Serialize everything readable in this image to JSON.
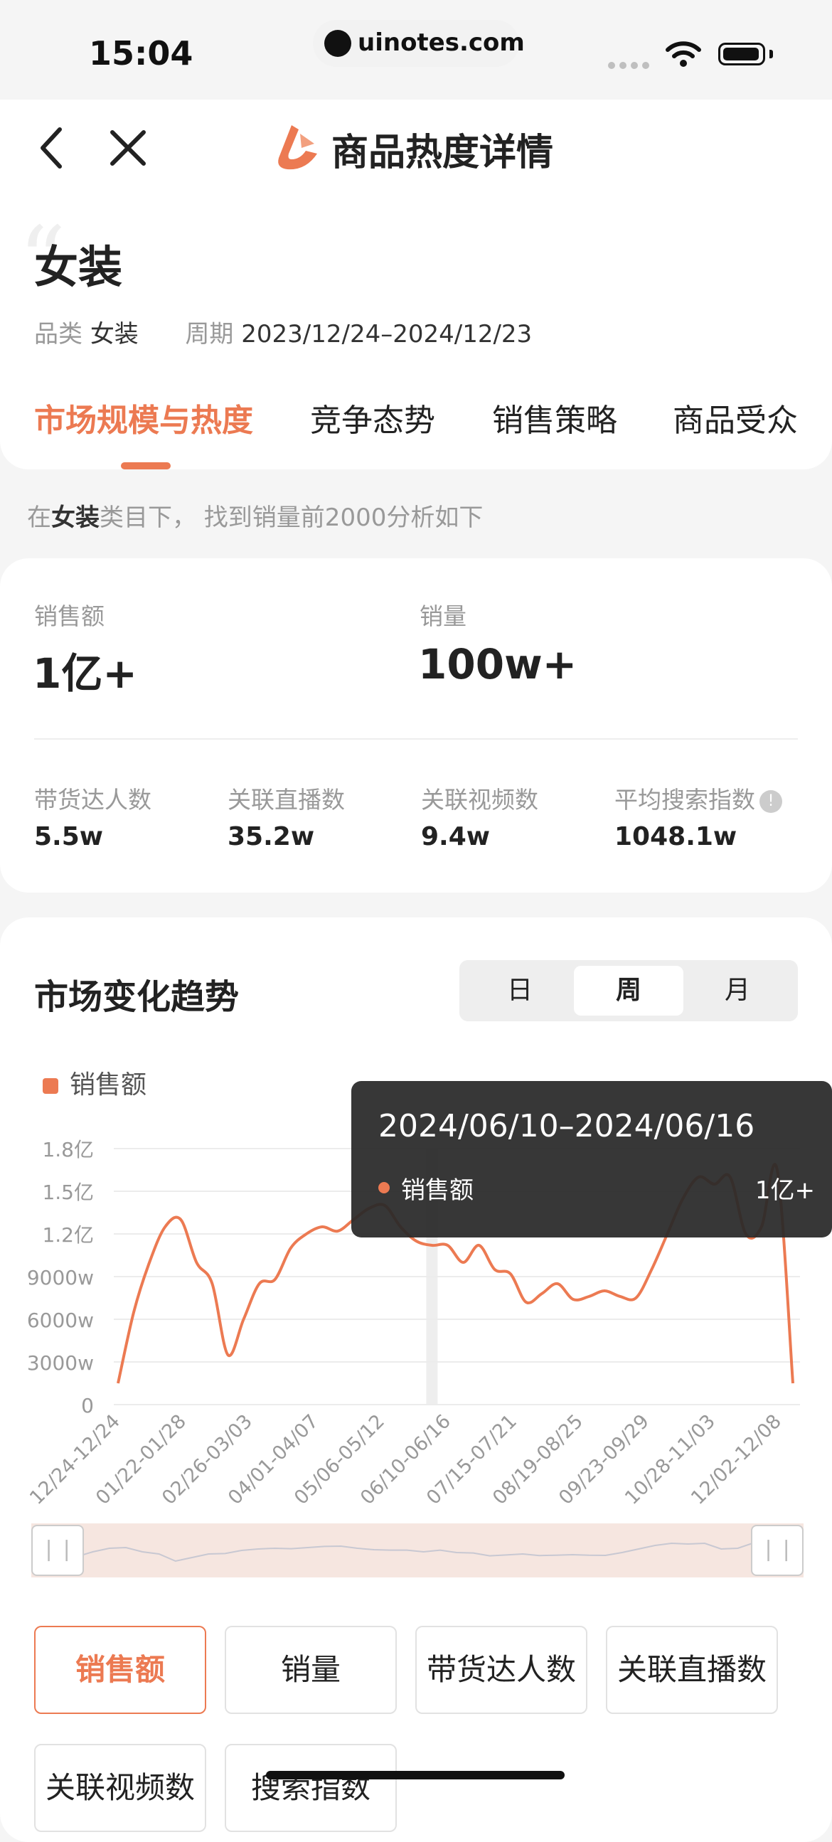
{
  "status_bar": {
    "time": "15:04",
    "url": "uinotes.com"
  },
  "nav": {
    "title": "商品热度详情"
  },
  "header": {
    "category_title": "女装",
    "meta": {
      "category_label": "品类",
      "category_value": "女装",
      "period_label": "周期",
      "period_value": "2023/12/24–2024/12/23"
    },
    "tabs": [
      {
        "label": "市场规模与热度",
        "active": true
      },
      {
        "label": "竞争态势"
      },
      {
        "label": "销售策略"
      },
      {
        "label": "商品受众"
      }
    ]
  },
  "notice": {
    "prefix": "在",
    "highlight": "女装",
    "suffix": "类目下， 找到销量前2000分析如下"
  },
  "stats": {
    "sales_amount": {
      "label": "销售额",
      "value": "1亿+"
    },
    "sales_volume": {
      "label": "销量",
      "value": "100w+"
    },
    "small": [
      {
        "label": "带货达人数",
        "value": "5.5w"
      },
      {
        "label": "关联直播数",
        "value": "35.2w"
      },
      {
        "label": "关联视频数",
        "value": "9.4w"
      },
      {
        "label": "平均搜索指数",
        "value": "1048.1w"
      }
    ]
  },
  "trend": {
    "title": "市场变化趋势",
    "segments": [
      {
        "label": "日"
      },
      {
        "label": "周",
        "active": true
      },
      {
        "label": "月"
      }
    ],
    "legend": "销售额",
    "tooltip": {
      "title": "2024/06/10–2024/06/16",
      "series": "销售额",
      "value": "1亿+"
    }
  },
  "chart_data": {
    "type": "line",
    "series": [
      {
        "name": "销售额",
        "color": "#ec7a52",
        "values": [
          0.15,
          0.65,
          1.0,
          1.25,
          1.3,
          1.0,
          0.85,
          0.35,
          0.6,
          0.85,
          0.88,
          1.1,
          1.2,
          1.25,
          1.22,
          1.3,
          1.38,
          1.4,
          1.25,
          1.15,
          1.12,
          1.12,
          1.0,
          1.12,
          0.95,
          0.92,
          0.72,
          0.78,
          0.85,
          0.74,
          0.76,
          0.8,
          0.76,
          0.75,
          0.95,
          1.2,
          1.45,
          1.6,
          1.55,
          1.6,
          1.2,
          1.25,
          1.65,
          0.15
        ]
      }
    ],
    "y_ticks": [
      "0",
      "3000w",
      "6000w",
      "9000w",
      "1.2亿",
      "1.5亿",
      "1.8亿"
    ],
    "ylim": [
      0,
      1.8
    ],
    "x_ticks": [
      "12/24-12/24",
      "01/22-01/28",
      "02/26-03/03",
      "04/01-04/07",
      "05/06-05/12",
      "06/10-06/16",
      "07/15-07/21",
      "08/19-08/25",
      "09/23-09/29",
      "10/28-11/03",
      "12/02-12/08"
    ],
    "highlight_index": 20,
    "grid": true,
    "legend_position": "top-left"
  },
  "metric_buttons": [
    {
      "label": "销售额",
      "active": true
    },
    {
      "label": "销量"
    },
    {
      "label": "带货达人数"
    },
    {
      "label": "关联直播数"
    },
    {
      "label": "关联视频数"
    },
    {
      "label": "搜索指数"
    }
  ]
}
